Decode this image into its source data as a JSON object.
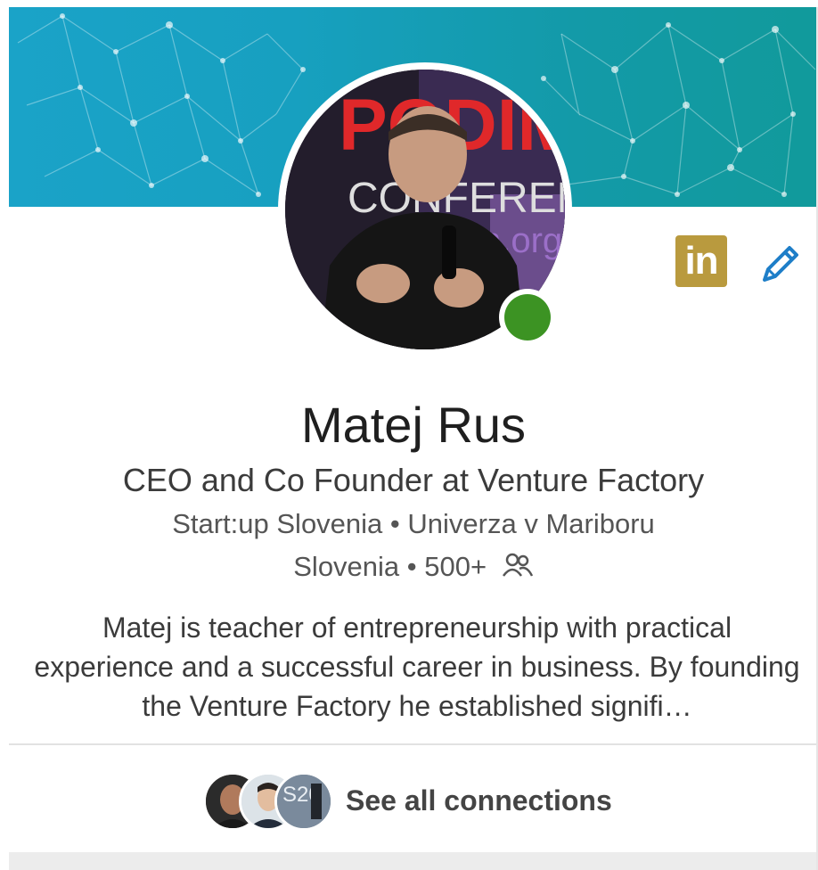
{
  "profile": {
    "name": "Matej Rus",
    "headline": "CEO and Co Founder at Venture Factory",
    "company": "Start:up Slovenia",
    "school": "Univerza v Mariboru",
    "location": "Slovenia",
    "connections_count": "500+",
    "separator": "•",
    "summary": "Matej is teacher of entrepreneurship with practical experience and a successful career in business. By founding the Venture Factory he established signifi…",
    "online": true
  },
  "avatar": {
    "poster_text_1": "PODIM",
    "poster_text_2": "CONFERENCE",
    "poster_text_3": "n.org"
  },
  "actions": {
    "linkedin_label": "in",
    "see_all_connections": "See all connections"
  },
  "colors": {
    "banner": "#1aa3c8",
    "online": "#3c9323",
    "linkedin_badge": "#b99a3e",
    "edit_icon": "#1e7ec8"
  },
  "icons": [
    "linkedin-icon",
    "pencil-icon",
    "connections-icon"
  ]
}
